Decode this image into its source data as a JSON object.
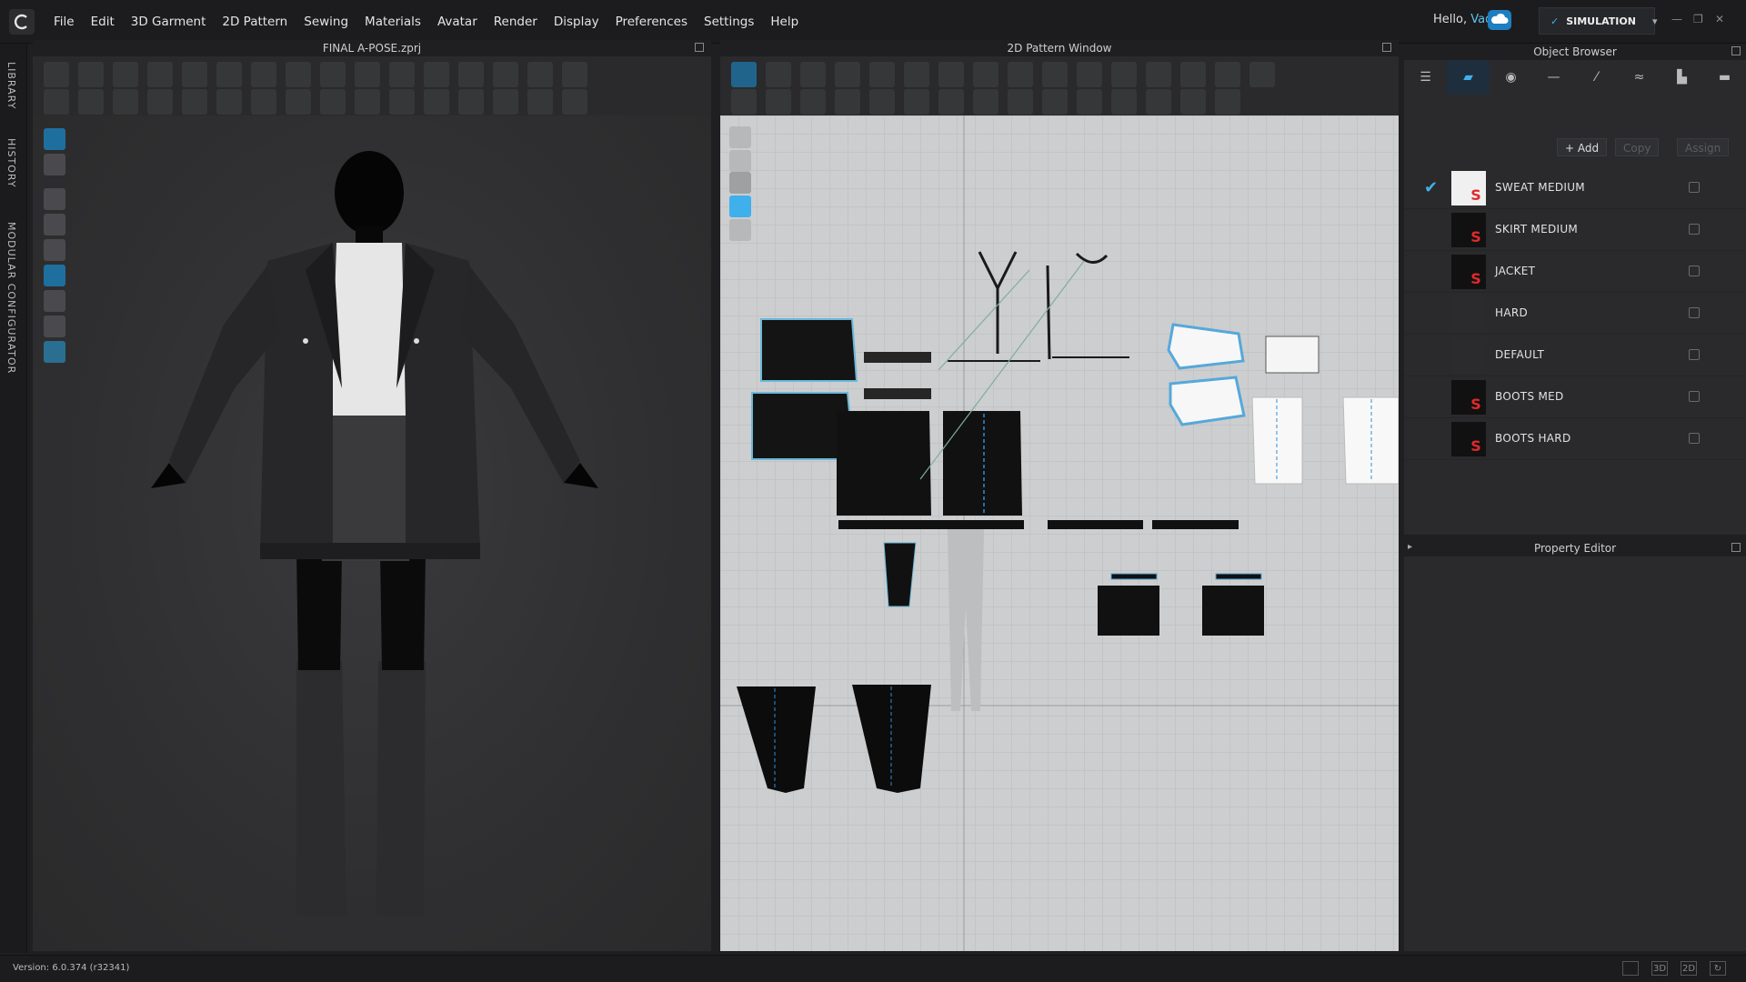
{
  "menubar": {
    "items": [
      "File",
      "Edit",
      "3D Garment",
      "2D Pattern",
      "Sewing",
      "Materials",
      "Avatar",
      "Render",
      "Display",
      "Preferences",
      "Settings",
      "Help"
    ],
    "greeting": "Hello,",
    "user": "Vadi",
    "mode": "SIMULATION"
  },
  "sidebar": {
    "tabs": [
      "LIBRARY",
      "HISTORY",
      "MODULAR CONFIGURATOR"
    ]
  },
  "view3d": {
    "title": "FINAL A-POSE.zprj"
  },
  "view2d": {
    "title": "2D Pattern Window"
  },
  "object_browser": {
    "title": "Object Browser",
    "add_label": "Add",
    "copy_label": "Copy",
    "assign_label": "Assign",
    "materials": [
      {
        "name": "SWEAT MEDIUM",
        "checked": true,
        "thumb": "white",
        "logo": true
      },
      {
        "name": "SKIRT MEDIUM",
        "checked": false,
        "thumb": "dark",
        "logo": true
      },
      {
        "name": "JACKET",
        "checked": false,
        "thumb": "dark",
        "logo": true
      },
      {
        "name": "HARD",
        "checked": false,
        "thumb": "empty",
        "logo": false
      },
      {
        "name": "DEFAULT",
        "checked": false,
        "thumb": "empty",
        "logo": false
      },
      {
        "name": "BOOTS MED",
        "checked": false,
        "thumb": "dark",
        "logo": true
      },
      {
        "name": "BOOTS HARD",
        "checked": false,
        "thumb": "dark",
        "logo": true
      }
    ]
  },
  "property_editor": {
    "title": "Property Editor"
  },
  "status": {
    "version": "Version: 6.0.374 (r32341)",
    "view_buttons": [
      "3D",
      "2D"
    ]
  },
  "colors": {
    "accent": "#3fb0ec",
    "brand_logo": "#e02a2a"
  }
}
